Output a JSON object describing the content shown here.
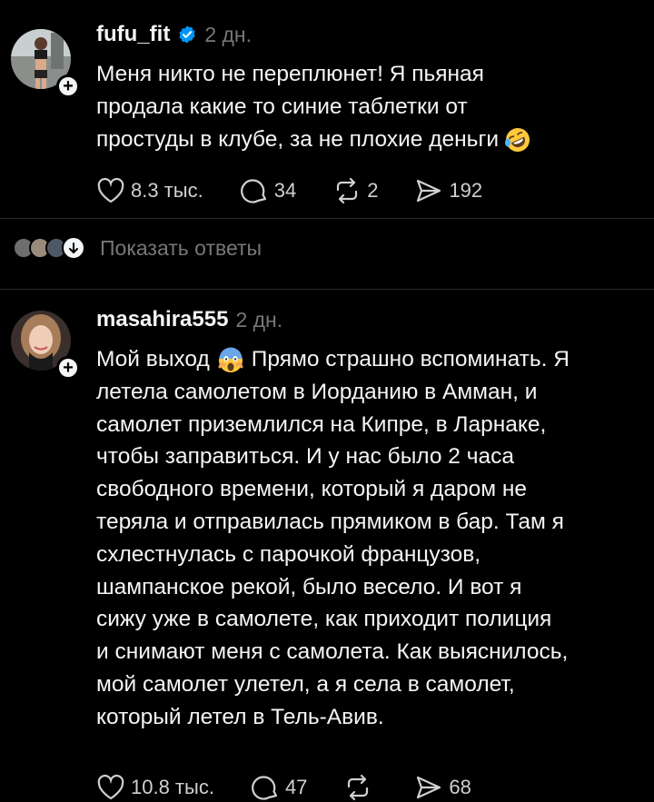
{
  "posts": [
    {
      "username": "fufu_fit",
      "verified": true,
      "timestamp": "2 дн.",
      "lines": [
        "Меня никто не переплюнет! Я пьяная",
        "продала какие то синие таблетки от",
        "простуды в клубе, за не плохие деньги"
      ],
      "emoji": "rolling-on-floor-laughing",
      "likes": "8.3 тыс.",
      "comments": "34",
      "reposts": "2",
      "shares": "192"
    },
    {
      "username": "masahira555",
      "verified": false,
      "timestamp": "2 дн.",
      "lines": [
        "Мой выход",
        "летела самолетом в Иорданию в Амман, и",
        "самолет приземлился на Кипре, в Ларнаке,",
        "чтобы заправиться. И у нас было 2 часа",
        "свободного времени, который я даром не",
        "теряла и отправилась прямиком в бар. Там я",
        "схлестнулась с парочкой французов,",
        "шампанское рекой, было весело. И вот я",
        "сижу уже в самолете, как приходит полиция",
        "и снимают меня с самолета. Как выяснилось,",
        "мой самолет улетел, а я села в самолет,",
        "который летел в Тель-Авив."
      ],
      "first_line_after_emoji": "Прямо страшно вспоминать. Я",
      "emoji": "face-screaming-in-fear",
      "likes": "10.8 тыс.",
      "comments": "47",
      "reposts": "",
      "shares": "68"
    }
  ],
  "show_replies_label": "Показать ответы",
  "colors": {
    "background": "#000000",
    "text": "#f3f5f7",
    "muted": "#777777",
    "verified": "#0095f6"
  }
}
